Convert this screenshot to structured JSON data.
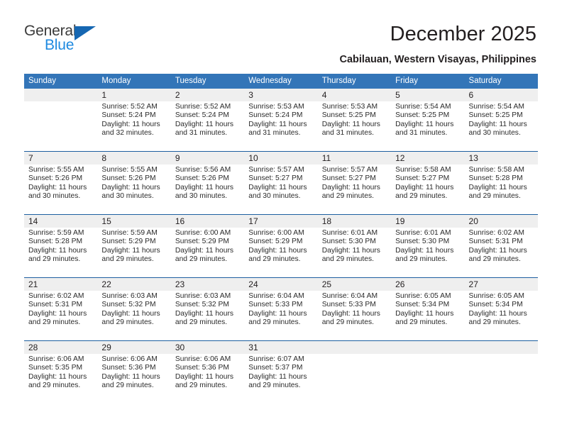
{
  "brand": {
    "name_part1": "General",
    "name_part2": "Blue",
    "triangle_icon": "triangle-icon",
    "color_dark": "#3b3b3b",
    "color_blue": "#1f8ae0",
    "color_triangle": "#1667b2"
  },
  "header": {
    "title": "December 2025",
    "subtitle": "Cabilauan, Western Visayas, Philippines"
  },
  "theme": {
    "header_band": "#3375b8",
    "week_divider": "#1d5fa0",
    "day_number_band": "#efefef",
    "text": "#231f20"
  },
  "weekdays": [
    "Sunday",
    "Monday",
    "Tuesday",
    "Wednesday",
    "Thursday",
    "Friday",
    "Saturday"
  ],
  "weeks": [
    [
      {
        "day": "",
        "lines": []
      },
      {
        "day": "1",
        "lines": [
          "Sunrise: 5:52 AM",
          "Sunset: 5:24 PM",
          "Daylight: 11 hours",
          "and 32 minutes."
        ]
      },
      {
        "day": "2",
        "lines": [
          "Sunrise: 5:52 AM",
          "Sunset: 5:24 PM",
          "Daylight: 11 hours",
          "and 31 minutes."
        ]
      },
      {
        "day": "3",
        "lines": [
          "Sunrise: 5:53 AM",
          "Sunset: 5:24 PM",
          "Daylight: 11 hours",
          "and 31 minutes."
        ]
      },
      {
        "day": "4",
        "lines": [
          "Sunrise: 5:53 AM",
          "Sunset: 5:25 PM",
          "Daylight: 11 hours",
          "and 31 minutes."
        ]
      },
      {
        "day": "5",
        "lines": [
          "Sunrise: 5:54 AM",
          "Sunset: 5:25 PM",
          "Daylight: 11 hours",
          "and 31 minutes."
        ]
      },
      {
        "day": "6",
        "lines": [
          "Sunrise: 5:54 AM",
          "Sunset: 5:25 PM",
          "Daylight: 11 hours",
          "and 30 minutes."
        ]
      }
    ],
    [
      {
        "day": "7",
        "lines": [
          "Sunrise: 5:55 AM",
          "Sunset: 5:26 PM",
          "Daylight: 11 hours",
          "and 30 minutes."
        ]
      },
      {
        "day": "8",
        "lines": [
          "Sunrise: 5:55 AM",
          "Sunset: 5:26 PM",
          "Daylight: 11 hours",
          "and 30 minutes."
        ]
      },
      {
        "day": "9",
        "lines": [
          "Sunrise: 5:56 AM",
          "Sunset: 5:26 PM",
          "Daylight: 11 hours",
          "and 30 minutes."
        ]
      },
      {
        "day": "10",
        "lines": [
          "Sunrise: 5:57 AM",
          "Sunset: 5:27 PM",
          "Daylight: 11 hours",
          "and 30 minutes."
        ]
      },
      {
        "day": "11",
        "lines": [
          "Sunrise: 5:57 AM",
          "Sunset: 5:27 PM",
          "Daylight: 11 hours",
          "and 29 minutes."
        ]
      },
      {
        "day": "12",
        "lines": [
          "Sunrise: 5:58 AM",
          "Sunset: 5:27 PM",
          "Daylight: 11 hours",
          "and 29 minutes."
        ]
      },
      {
        "day": "13",
        "lines": [
          "Sunrise: 5:58 AM",
          "Sunset: 5:28 PM",
          "Daylight: 11 hours",
          "and 29 minutes."
        ]
      }
    ],
    [
      {
        "day": "14",
        "lines": [
          "Sunrise: 5:59 AM",
          "Sunset: 5:28 PM",
          "Daylight: 11 hours",
          "and 29 minutes."
        ]
      },
      {
        "day": "15",
        "lines": [
          "Sunrise: 5:59 AM",
          "Sunset: 5:29 PM",
          "Daylight: 11 hours",
          "and 29 minutes."
        ]
      },
      {
        "day": "16",
        "lines": [
          "Sunrise: 6:00 AM",
          "Sunset: 5:29 PM",
          "Daylight: 11 hours",
          "and 29 minutes."
        ]
      },
      {
        "day": "17",
        "lines": [
          "Sunrise: 6:00 AM",
          "Sunset: 5:29 PM",
          "Daylight: 11 hours",
          "and 29 minutes."
        ]
      },
      {
        "day": "18",
        "lines": [
          "Sunrise: 6:01 AM",
          "Sunset: 5:30 PM",
          "Daylight: 11 hours",
          "and 29 minutes."
        ]
      },
      {
        "day": "19",
        "lines": [
          "Sunrise: 6:01 AM",
          "Sunset: 5:30 PM",
          "Daylight: 11 hours",
          "and 29 minutes."
        ]
      },
      {
        "day": "20",
        "lines": [
          "Sunrise: 6:02 AM",
          "Sunset: 5:31 PM",
          "Daylight: 11 hours",
          "and 29 minutes."
        ]
      }
    ],
    [
      {
        "day": "21",
        "lines": [
          "Sunrise: 6:02 AM",
          "Sunset: 5:31 PM",
          "Daylight: 11 hours",
          "and 29 minutes."
        ]
      },
      {
        "day": "22",
        "lines": [
          "Sunrise: 6:03 AM",
          "Sunset: 5:32 PM",
          "Daylight: 11 hours",
          "and 29 minutes."
        ]
      },
      {
        "day": "23",
        "lines": [
          "Sunrise: 6:03 AM",
          "Sunset: 5:32 PM",
          "Daylight: 11 hours",
          "and 29 minutes."
        ]
      },
      {
        "day": "24",
        "lines": [
          "Sunrise: 6:04 AM",
          "Sunset: 5:33 PM",
          "Daylight: 11 hours",
          "and 29 minutes."
        ]
      },
      {
        "day": "25",
        "lines": [
          "Sunrise: 6:04 AM",
          "Sunset: 5:33 PM",
          "Daylight: 11 hours",
          "and 29 minutes."
        ]
      },
      {
        "day": "26",
        "lines": [
          "Sunrise: 6:05 AM",
          "Sunset: 5:34 PM",
          "Daylight: 11 hours",
          "and 29 minutes."
        ]
      },
      {
        "day": "27",
        "lines": [
          "Sunrise: 6:05 AM",
          "Sunset: 5:34 PM",
          "Daylight: 11 hours",
          "and 29 minutes."
        ]
      }
    ],
    [
      {
        "day": "28",
        "lines": [
          "Sunrise: 6:06 AM",
          "Sunset: 5:35 PM",
          "Daylight: 11 hours",
          "and 29 minutes."
        ]
      },
      {
        "day": "29",
        "lines": [
          "Sunrise: 6:06 AM",
          "Sunset: 5:36 PM",
          "Daylight: 11 hours",
          "and 29 minutes."
        ]
      },
      {
        "day": "30",
        "lines": [
          "Sunrise: 6:06 AM",
          "Sunset: 5:36 PM",
          "Daylight: 11 hours",
          "and 29 minutes."
        ]
      },
      {
        "day": "31",
        "lines": [
          "Sunrise: 6:07 AM",
          "Sunset: 5:37 PM",
          "Daylight: 11 hours",
          "and 29 minutes."
        ]
      },
      {
        "day": "",
        "lines": []
      },
      {
        "day": "",
        "lines": []
      },
      {
        "day": "",
        "lines": []
      }
    ]
  ]
}
